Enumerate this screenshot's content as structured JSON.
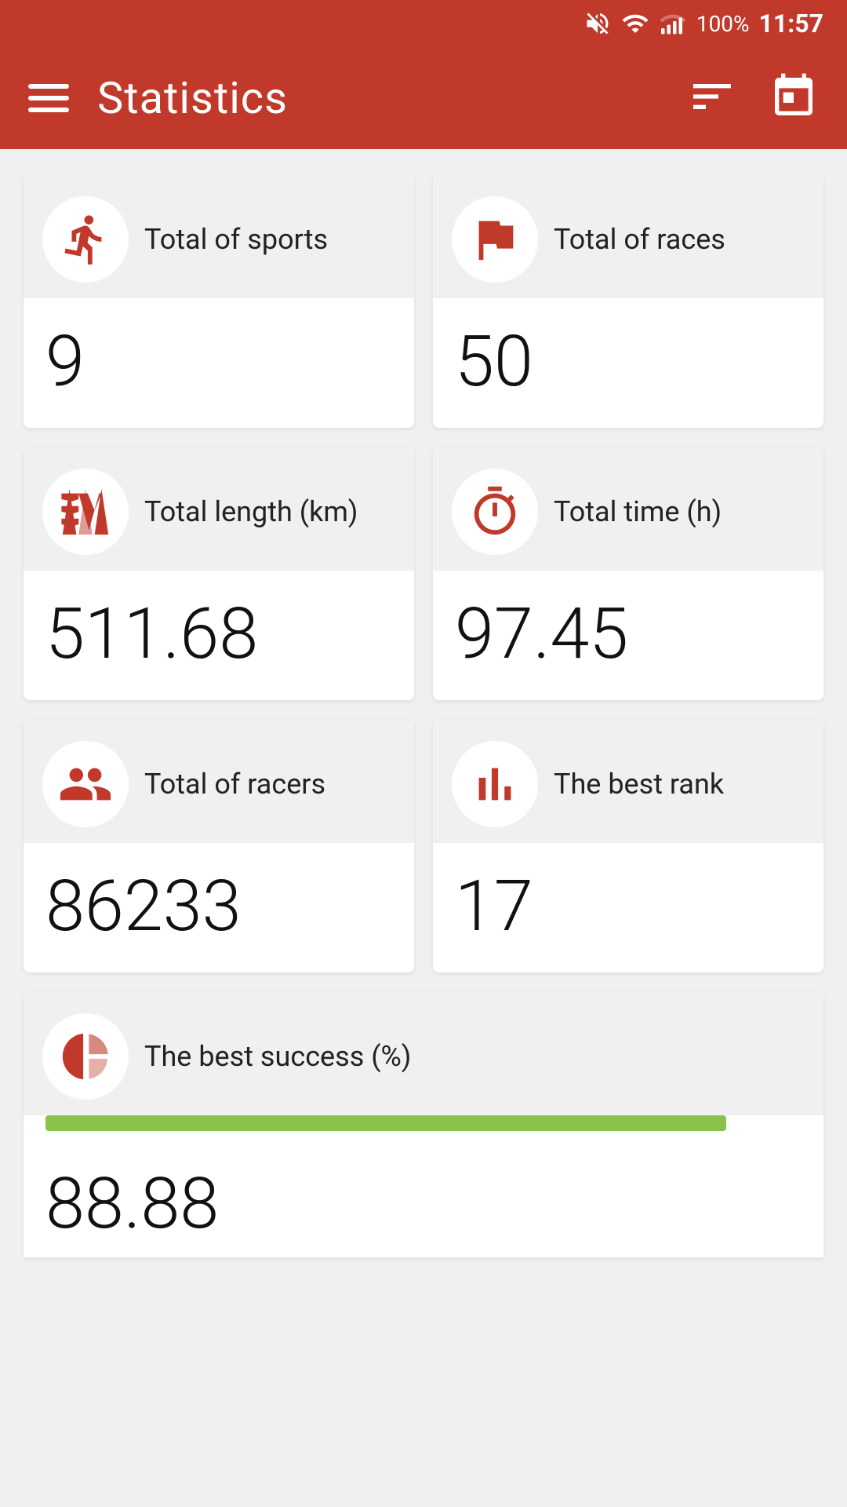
{
  "statusBar": {
    "time": "11:57",
    "battery": "100%"
  },
  "header": {
    "title": "Statistics",
    "hamburger_label": "menu",
    "filter_label": "filter",
    "calendar_label": "calendar"
  },
  "stats": [
    {
      "id": "total-sports",
      "label": "Total of sports",
      "value": "9",
      "icon": "running-icon"
    },
    {
      "id": "total-races",
      "label": "Total of races",
      "value": "50",
      "icon": "flag-icon"
    },
    {
      "id": "total-length",
      "label": "Total length (km)",
      "value": "511.68",
      "icon": "road-icon"
    },
    {
      "id": "total-time",
      "label": "Total time (h)",
      "value": "97.45",
      "icon": "timer-icon"
    },
    {
      "id": "total-racers",
      "label": "Total of racers",
      "value": "86233",
      "icon": "group-icon"
    },
    {
      "id": "best-rank",
      "label": "The best rank",
      "value": "17",
      "icon": "rank-icon"
    }
  ],
  "bottomCard": {
    "label": "The best success (%)",
    "icon": "pie-chart-icon",
    "partial_value": "88.88"
  }
}
